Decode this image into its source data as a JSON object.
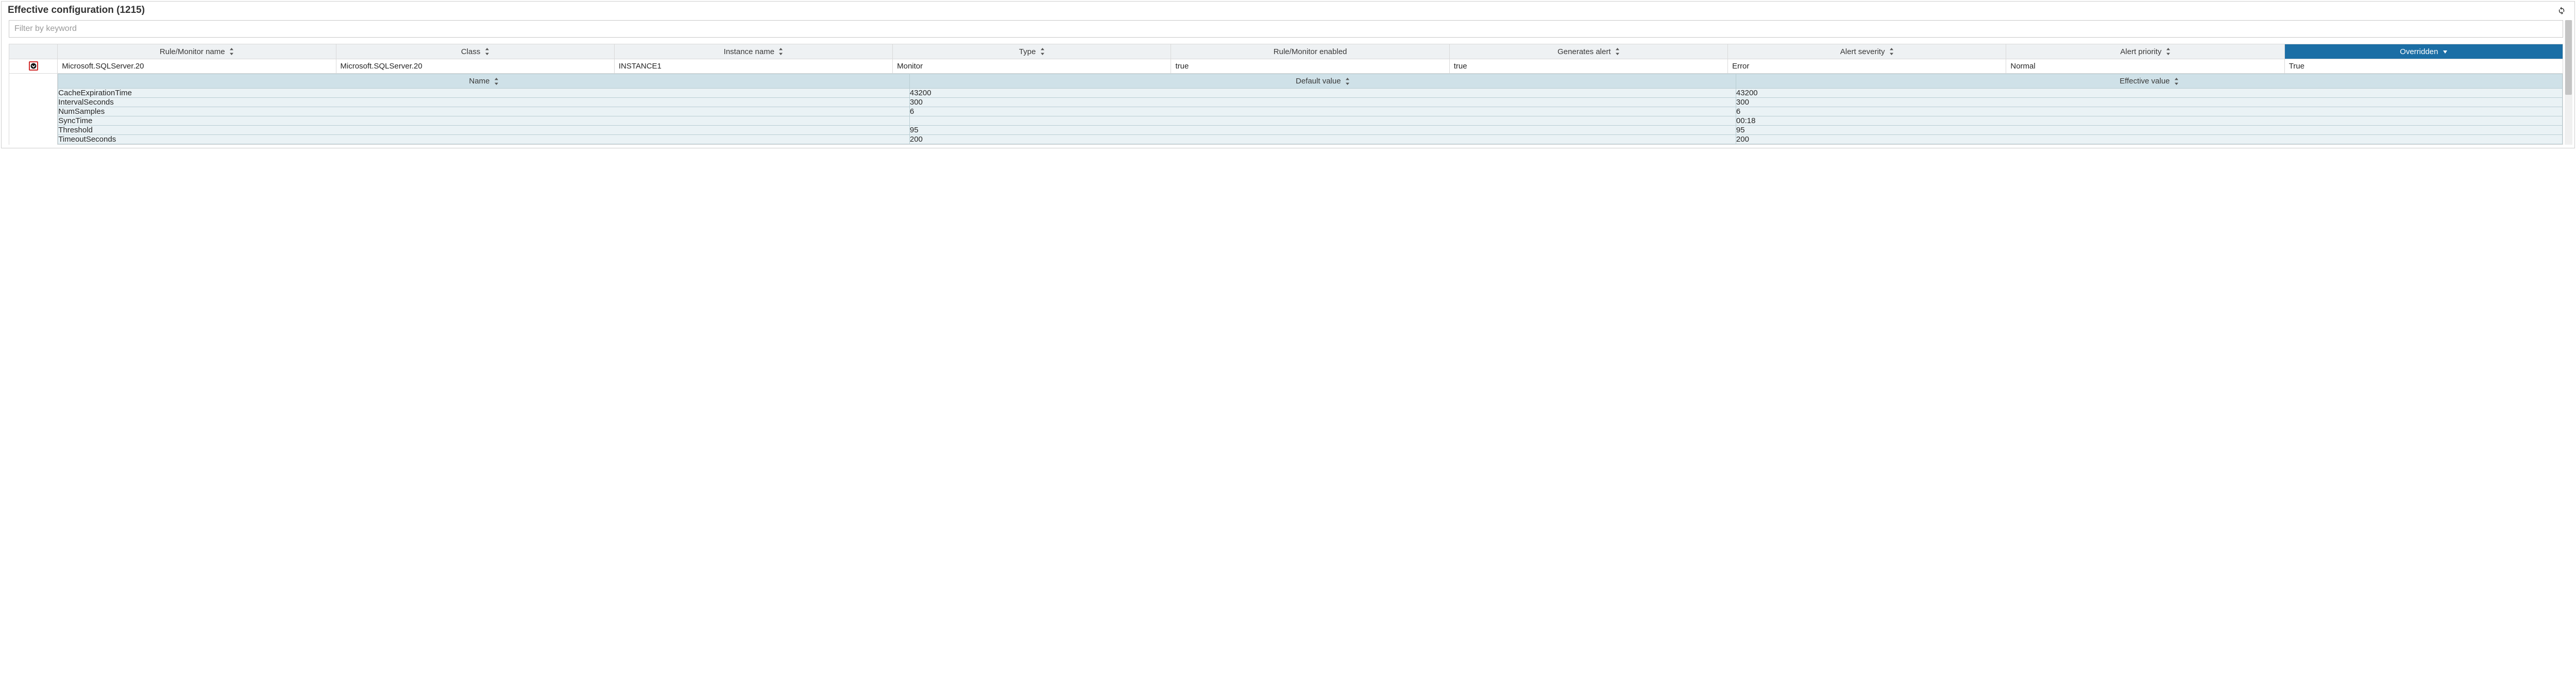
{
  "header": {
    "title": "Effective configuration (1215)"
  },
  "filter": {
    "placeholder": "Filter by keyword"
  },
  "columns": {
    "rule_monitor_name": "Rule/Monitor name",
    "class": "Class",
    "instance_name": "Instance name",
    "type": "Type",
    "rule_monitor_enabled": "Rule/Monitor enabled",
    "generates_alert": "Generates alert",
    "alert_severity": "Alert severity",
    "alert_priority": "Alert priority",
    "overridden": "Overridden"
  },
  "row": {
    "rule_monitor_name": "Microsoft.SQLServer.20",
    "class": "Microsoft.SQLServer.20",
    "instance_name": "INSTANCE1",
    "type": "Monitor",
    "rule_monitor_enabled": "true",
    "generates_alert": "true",
    "alert_severity": "Error",
    "alert_priority": "Normal",
    "overridden": "True"
  },
  "detail_columns": {
    "name": "Name",
    "default_value": "Default value",
    "effective_value": "Effective value"
  },
  "details": [
    {
      "name": "CacheExpirationTime",
      "default": "43200",
      "effective": "43200"
    },
    {
      "name": "IntervalSeconds",
      "default": "300",
      "effective": "300"
    },
    {
      "name": "NumSamples",
      "default": "6",
      "effective": "6"
    },
    {
      "name": "SyncTime",
      "default": "",
      "effective": "00:18"
    },
    {
      "name": "Threshold",
      "default": "95",
      "effective": "95"
    },
    {
      "name": "TimeoutSeconds",
      "default": "200",
      "effective": "200"
    }
  ]
}
